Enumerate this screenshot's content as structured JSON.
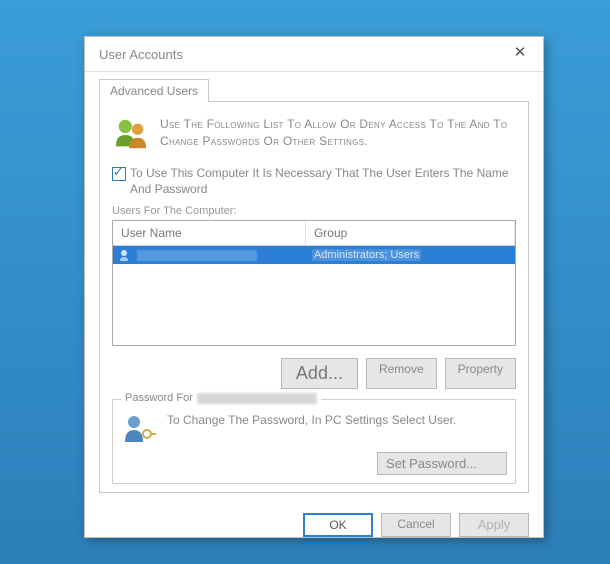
{
  "dialog": {
    "title": "User Accounts",
    "tabs": {
      "advanced": "Advanced Users"
    },
    "intro": "Use The Following List To Allow Or Deny Access To The And To Change Passwords Or Other Settings.",
    "checkbox": {
      "checked": true,
      "label": "To Use This Computer It Is Necessary That The User Enters The Name And Password"
    },
    "listLabel": "Users For The Computer:",
    "columns": {
      "user": "User Name",
      "group": "Group"
    },
    "rows": [
      {
        "user": "",
        "group": "Administrators; Users"
      }
    ],
    "buttons": {
      "add": "Add...",
      "remove": "Remove",
      "property": "Property"
    },
    "passwordSection": {
      "legend": "Password For",
      "text": "To Change The Password, In PC Settings Select User.",
      "setPassword": "Set Password..."
    },
    "dialogButtons": {
      "ok": "OK",
      "cancel": "Cancel",
      "apply": "Apply"
    }
  }
}
